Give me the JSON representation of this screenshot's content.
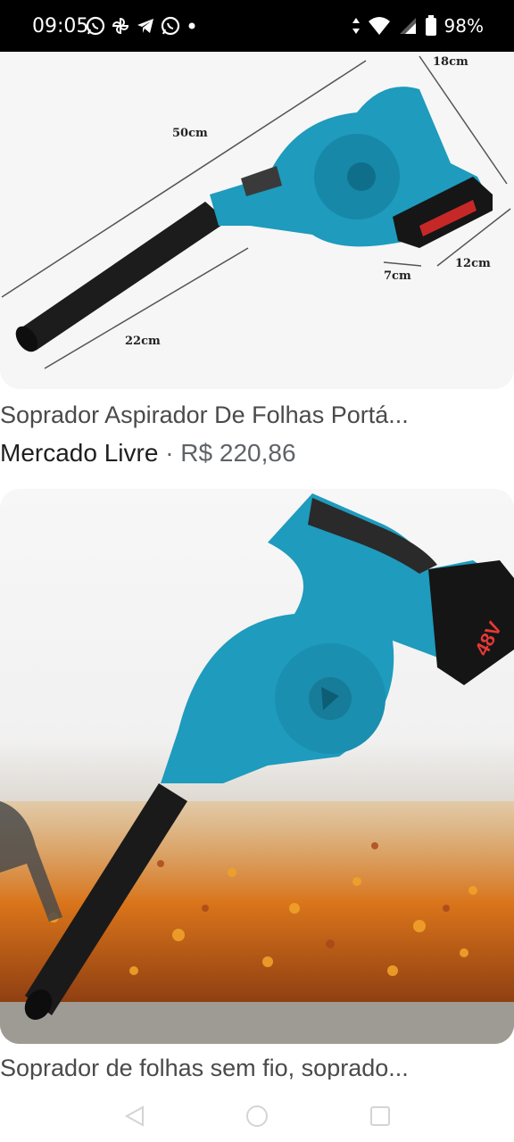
{
  "status_bar": {
    "time": "09:05",
    "battery": "98%",
    "left_icons": [
      "whatsapp-icon",
      "pinwheel-icon",
      "telegram-icon",
      "whatsapp-icon",
      "dot-icon"
    ],
    "right_icons": [
      "data-arrows-icon",
      "wifi-icon",
      "signal-icon",
      "battery-icon"
    ]
  },
  "results": [
    {
      "image_labels": {
        "length": "50cm",
        "depth": "18cm",
        "height": "12cm",
        "handle": "7cm",
        "nozzle": "22cm"
      },
      "title": "Soprador Aspirador De Folhas Portá...",
      "source": "Mercado Livre",
      "separator": "·",
      "price": "R$ 220,86"
    },
    {
      "image_labels": {
        "battery_text": "48V"
      },
      "title": "Soprador de folhas sem fio, soprado..."
    }
  ],
  "nav_bar": {
    "buttons": [
      "back-button",
      "home-button",
      "recents-button"
    ]
  },
  "colors": {
    "tool_teal": "#1e9bbd",
    "status_bar": "#000000",
    "leaf_orange": "#d9741a"
  }
}
